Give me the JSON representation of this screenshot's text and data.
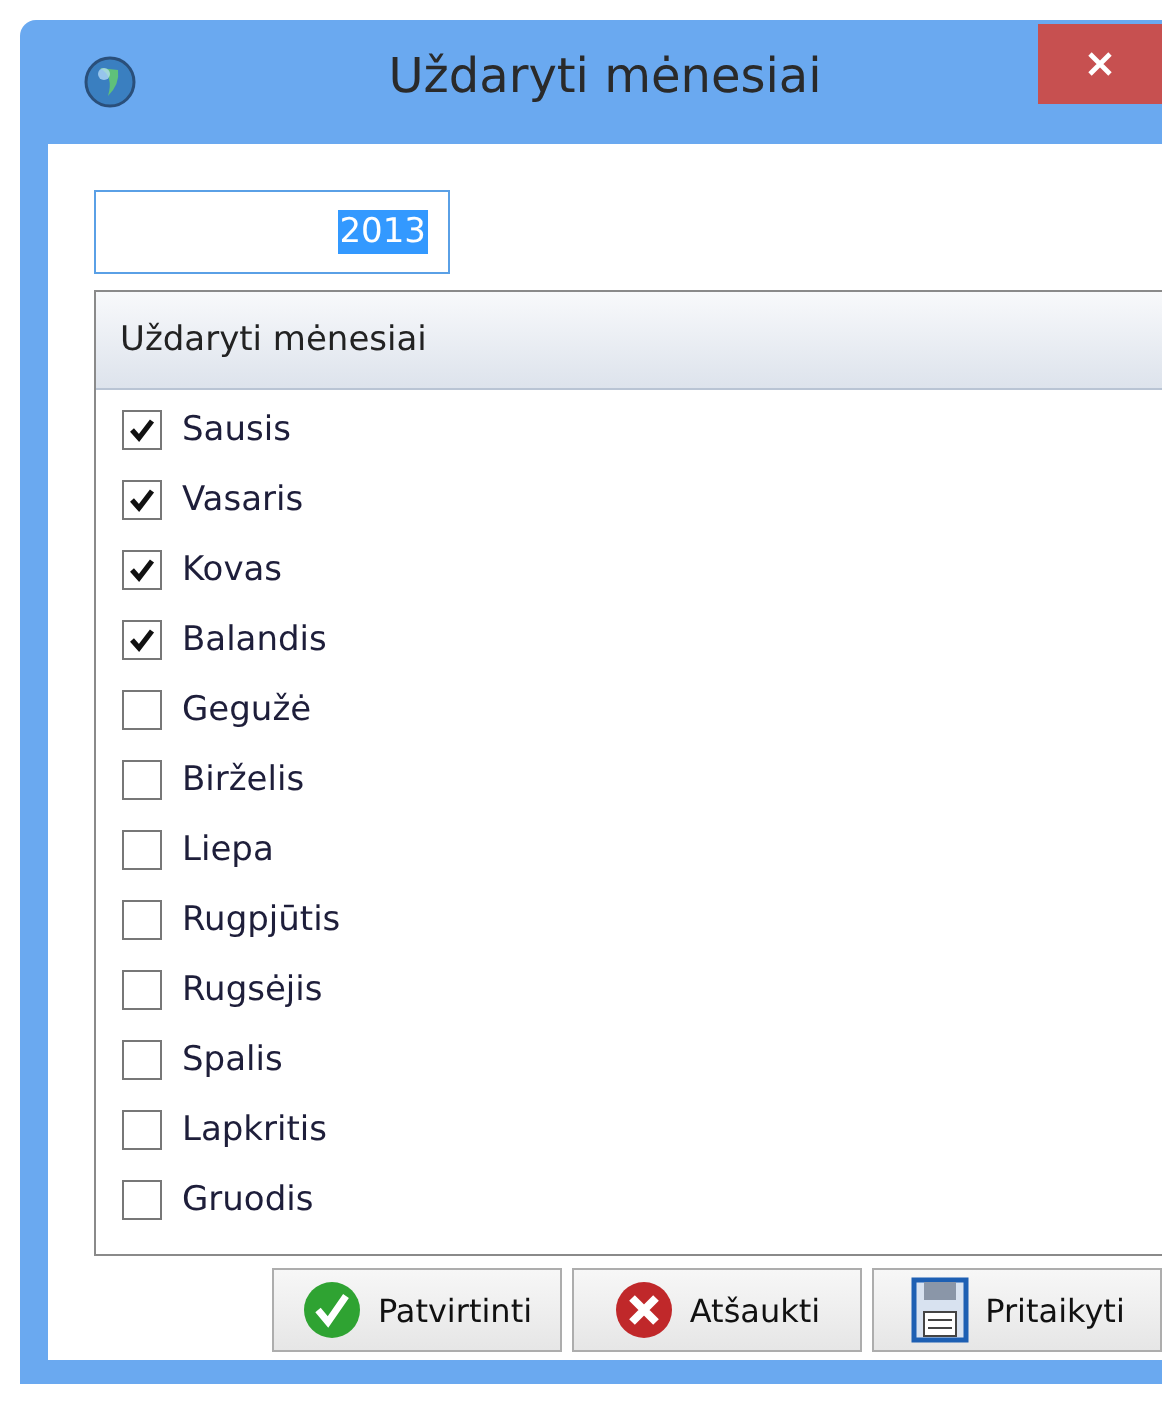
{
  "window": {
    "title": "Uždaryti mėnesiai"
  },
  "year_field": {
    "value": "2013",
    "selected": true
  },
  "list": {
    "header": "Uždaryti mėnesiai",
    "items": [
      {
        "label": "Sausis",
        "checked": true
      },
      {
        "label": "Vasaris",
        "checked": true
      },
      {
        "label": "Kovas",
        "checked": true
      },
      {
        "label": "Balandis",
        "checked": true
      },
      {
        "label": "Gegužė",
        "checked": false
      },
      {
        "label": "Birželis",
        "checked": false
      },
      {
        "label": "Liepa",
        "checked": false
      },
      {
        "label": "Rugpjūtis",
        "checked": false
      },
      {
        "label": "Rugsėjis",
        "checked": false
      },
      {
        "label": "Spalis",
        "checked": false
      },
      {
        "label": "Lapkritis",
        "checked": false
      },
      {
        "label": "Gruodis",
        "checked": false
      }
    ]
  },
  "buttons": [
    {
      "label": "Patvirtinti",
      "kind": "confirm"
    },
    {
      "label": "Atšaukti",
      "kind": "cancel"
    },
    {
      "label": "Pritaikyti",
      "kind": "apply"
    }
  ]
}
